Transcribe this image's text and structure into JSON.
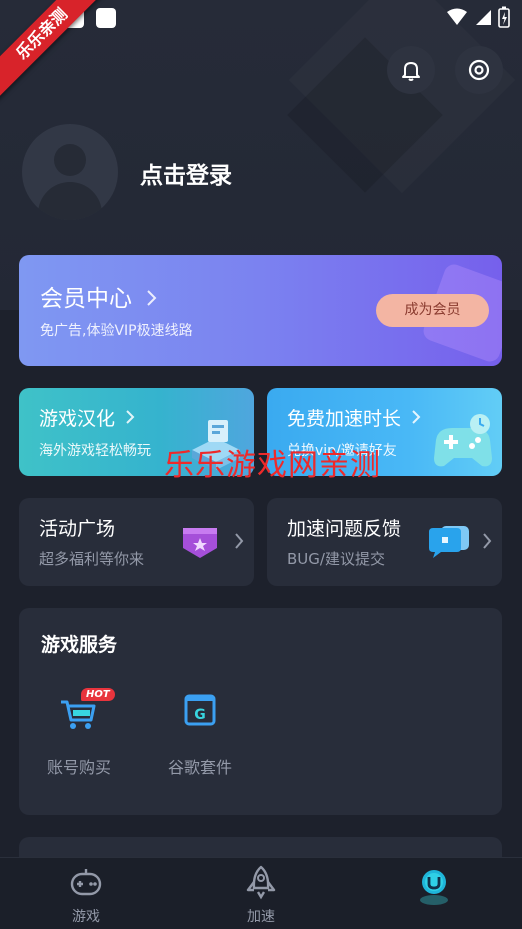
{
  "watermark": {
    "ribbon": "乐乐亲测",
    "overlay": "乐乐游戏网亲测"
  },
  "header": {
    "login_text": "点击登录"
  },
  "vip": {
    "title": "会员中心",
    "subtitle": "免广告,体验VIP极速线路",
    "button": "成为会员"
  },
  "feature_cards": [
    {
      "title": "游戏汉化",
      "subtitle": "海外游戏轻松畅玩"
    },
    {
      "title": "免费加速时长",
      "subtitle": "兑换vip/邀请好友"
    }
  ],
  "mini_cards": [
    {
      "title": "活动广场",
      "subtitle": "超多福利等你来"
    },
    {
      "title": "加速问题反馈",
      "subtitle": "BUG/建议提交"
    }
  ],
  "services": {
    "title": "游戏服务",
    "items": [
      {
        "label": "账号购买",
        "badge": "HOT",
        "icon": "cart-icon"
      },
      {
        "label": "谷歌套件",
        "icon": "google-g-icon"
      }
    ]
  },
  "tabbar": {
    "items": [
      {
        "label": "游戏",
        "icon": "gamepad-icon"
      },
      {
        "label": "加速",
        "icon": "rocket-icon"
      },
      {
        "label": "",
        "icon": "profile-u-icon"
      }
    ]
  },
  "colors": {
    "background": "#1d212c",
    "card": "#282d3a",
    "vip_gradient_start": "#7f98f2",
    "vip_gradient_end": "#7660ec",
    "vip_button": "#f3b5a3",
    "accent_cyan": "#3fc2c8",
    "watermark_red": "#ee2a2a"
  }
}
